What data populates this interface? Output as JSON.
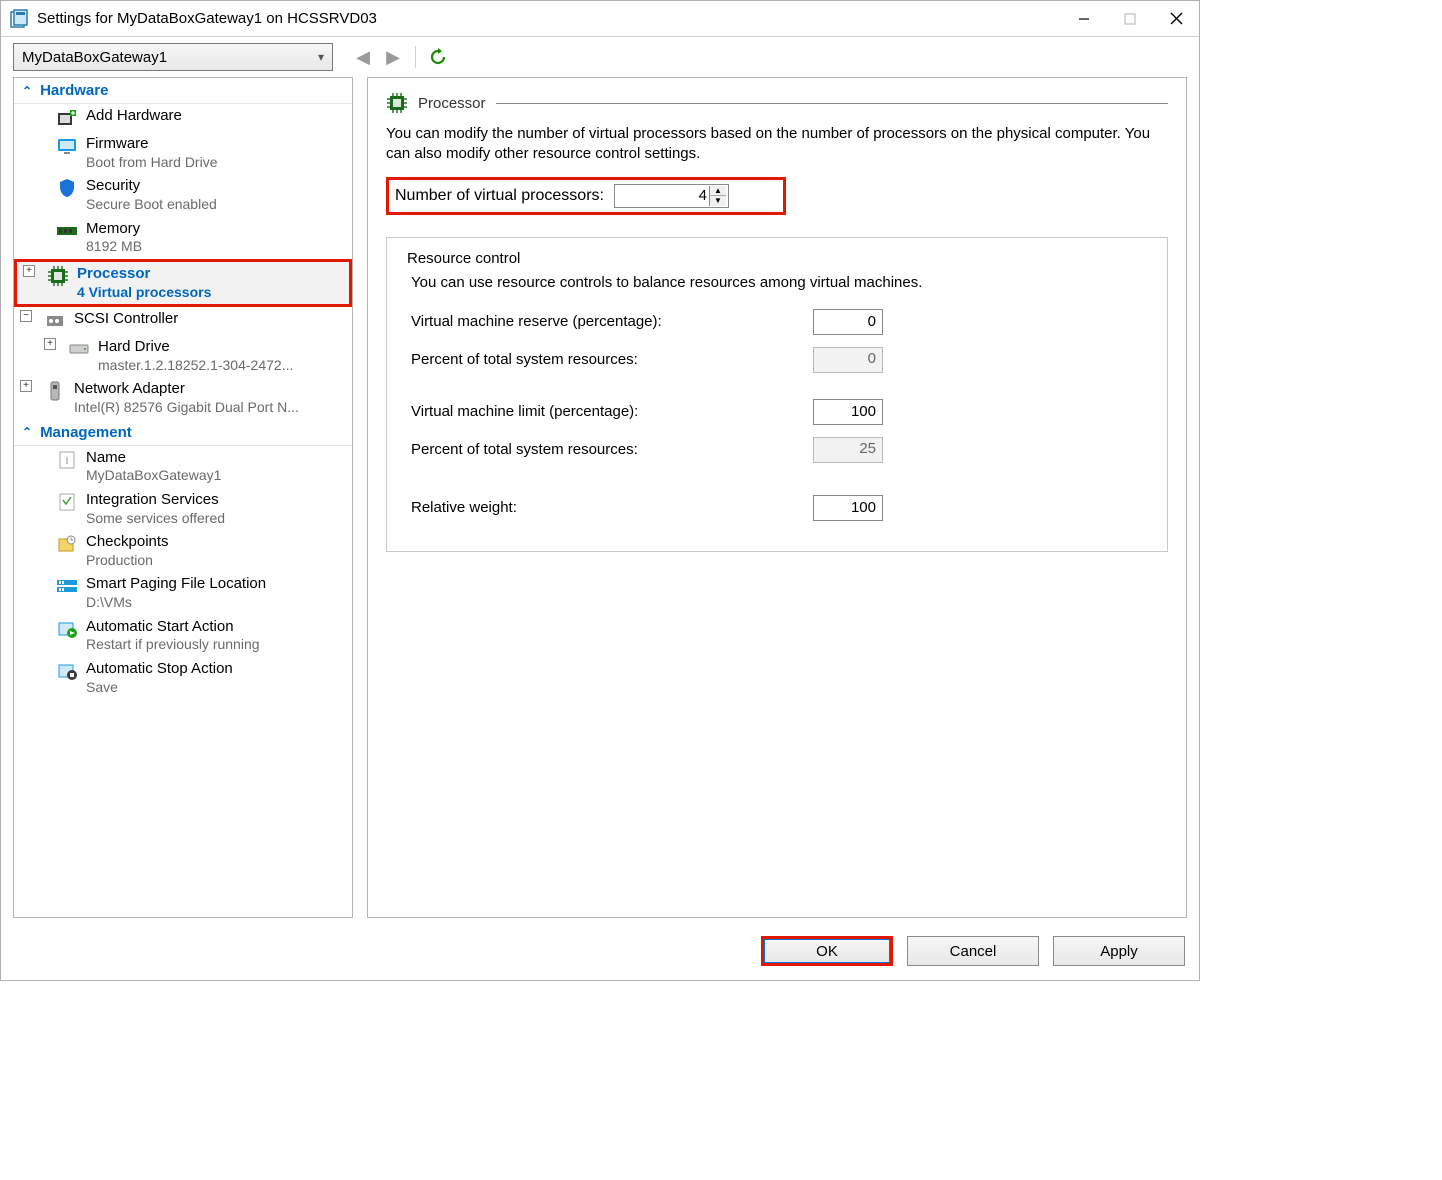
{
  "window": {
    "title": "Settings for MyDataBoxGateway1 on HCSSRVD03"
  },
  "toolbar": {
    "vm_name": "MyDataBoxGateway1"
  },
  "tree": {
    "section_hardware": "Hardware",
    "section_management": "Management",
    "add_hardware": "Add Hardware",
    "firmware": {
      "label": "Firmware",
      "sub": "Boot from Hard Drive"
    },
    "security": {
      "label": "Security",
      "sub": "Secure Boot enabled"
    },
    "memory": {
      "label": "Memory",
      "sub": "8192 MB"
    },
    "processor": {
      "label": "Processor",
      "sub": "4 Virtual processors"
    },
    "scsi": {
      "label": "SCSI Controller"
    },
    "hard_drive": {
      "label": "Hard Drive",
      "sub": "master.1.2.18252.1-304-2472..."
    },
    "network": {
      "label": "Network Adapter",
      "sub": "Intel(R) 82576 Gigabit Dual Port N..."
    },
    "name": {
      "label": "Name",
      "sub": "MyDataBoxGateway1"
    },
    "integration": {
      "label": "Integration Services",
      "sub": "Some services offered"
    },
    "checkpoints": {
      "label": "Checkpoints",
      "sub": "Production"
    },
    "smart_paging": {
      "label": "Smart Paging File Location",
      "sub": "D:\\VMs"
    },
    "auto_start": {
      "label": "Automatic Start Action",
      "sub": "Restart if previously running"
    },
    "auto_stop": {
      "label": "Automatic Stop Action",
      "sub": "Save"
    }
  },
  "pane": {
    "heading": "Processor",
    "description": "You can modify the number of virtual processors based on the number of processors on the physical computer. You can also modify other resource control settings.",
    "num_label": "Number of virtual processors:",
    "num_value": "4",
    "resource": {
      "legend": "Resource control",
      "note": "You can use resource controls to balance resources among virtual machines.",
      "reserve_label": "Virtual machine reserve (percentage):",
      "reserve_value": "0",
      "percent1_label": "Percent of total system resources:",
      "percent1_value": "0",
      "limit_label": "Virtual machine limit (percentage):",
      "limit_value": "100",
      "percent2_label": "Percent of total system resources:",
      "percent2_value": "25",
      "weight_label": "Relative weight:",
      "weight_value": "100"
    }
  },
  "buttons": {
    "ok": "OK",
    "cancel": "Cancel",
    "apply": "Apply"
  }
}
